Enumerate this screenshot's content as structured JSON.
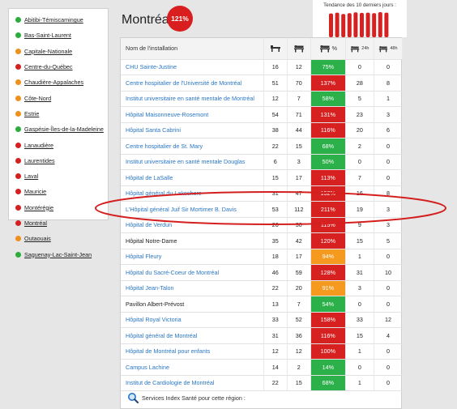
{
  "page": {
    "title": "Montréal",
    "badge": "121%",
    "trend_title": "Tendance des 10 derniers jours :",
    "trend_values": [
      0.92,
      0.95,
      0.9,
      0.93,
      0.96,
      0.94,
      0.95,
      0.93,
      0.97,
      0.95
    ],
    "footer_text": "Services Index Santé pour cette région :"
  },
  "sidebar": {
    "items": [
      {
        "label": "Abitibi-Témiscamingue",
        "status": "green"
      },
      {
        "label": "Bas-Saint-Laurent",
        "status": "green"
      },
      {
        "label": "Capitale-Nationale",
        "status": "orange"
      },
      {
        "label": "Centre-du-Québec",
        "status": "red"
      },
      {
        "label": "Chaudière-Appalaches",
        "status": "orange"
      },
      {
        "label": "Côte-Nord",
        "status": "orange"
      },
      {
        "label": "Estrie",
        "status": "orange"
      },
      {
        "label": "Gaspésie-Îles-de-la-Madeleine",
        "status": "green"
      },
      {
        "label": "Lanaudière",
        "status": "red"
      },
      {
        "label": "Laurentides",
        "status": "red"
      },
      {
        "label": "Laval",
        "status": "red"
      },
      {
        "label": "Mauricie",
        "status": "red"
      },
      {
        "label": "Montérégie",
        "status": "red"
      },
      {
        "label": "Montréal",
        "status": "red"
      },
      {
        "label": "Outaouais",
        "status": "orange"
      },
      {
        "label": "Saguenay-Lac-Saint-Jean",
        "status": "green"
      }
    ]
  },
  "table": {
    "headers": {
      "name": "Nom de l'installation",
      "pct": "%",
      "h24": "24h",
      "h48": "48h"
    },
    "rows": [
      {
        "name": "CHU Sainte-Justine",
        "link": true,
        "a": "16",
        "b": "12",
        "pct": "75%",
        "status": "green",
        "h24": "0",
        "h48": "0"
      },
      {
        "name": "Centre hospitalier de l'Université de Montréal",
        "link": true,
        "a": "51",
        "b": "70",
        "pct": "137%",
        "status": "red",
        "h24": "28",
        "h48": "8"
      },
      {
        "name": "Institut universitaire en santé mentale de Montréal",
        "link": true,
        "a": "12",
        "b": "7",
        "pct": "58%",
        "status": "green",
        "h24": "5",
        "h48": "1"
      },
      {
        "name": "Hôpital Maisonneuve-Rosemont",
        "link": true,
        "a": "54",
        "b": "71",
        "pct": "131%",
        "status": "red",
        "h24": "23",
        "h48": "3"
      },
      {
        "name": "Hôpital Santa Cabrini",
        "link": true,
        "a": "38",
        "b": "44",
        "pct": "116%",
        "status": "red",
        "h24": "20",
        "h48": "6"
      },
      {
        "name": "Centre hospitalier de St. Mary",
        "link": true,
        "a": "22",
        "b": "15",
        "pct": "68%",
        "status": "green",
        "h24": "2",
        "h48": "0"
      },
      {
        "name": "Institut universitaire en santé mentale Douglas",
        "link": true,
        "a": "6",
        "b": "3",
        "pct": "50%",
        "status": "green",
        "h24": "0",
        "h48": "0"
      },
      {
        "name": "Hôpital de LaSalle",
        "link": true,
        "a": "15",
        "b": "17",
        "pct": "113%",
        "status": "red",
        "h24": "7",
        "h48": "0"
      },
      {
        "name": "Hôpital général du Lakeshore",
        "link": true,
        "a": "31",
        "b": "47",
        "pct": "152%",
        "status": "red",
        "h24": "16",
        "h48": "8"
      },
      {
        "name": "L'Hôpital général Juif Sir Mortimer B. Davis",
        "link": true,
        "a": "53",
        "b": "112",
        "pct": "211%",
        "status": "red",
        "h24": "19",
        "h48": "3"
      },
      {
        "name": "Hôpital de Verdun",
        "link": true,
        "a": "26",
        "b": "30",
        "pct": "115%",
        "status": "red",
        "h24": "9",
        "h48": "3"
      },
      {
        "name": "Hôpital Notre-Dame",
        "link": false,
        "a": "35",
        "b": "42",
        "pct": "120%",
        "status": "red",
        "h24": "15",
        "h48": "5"
      },
      {
        "name": "Hôpital Fleury",
        "link": true,
        "a": "18",
        "b": "17",
        "pct": "94%",
        "status": "orange",
        "h24": "1",
        "h48": "0"
      },
      {
        "name": "Hôpital du Sacré-Coeur de Montréal",
        "link": true,
        "a": "46",
        "b": "59",
        "pct": "128%",
        "status": "red",
        "h24": "31",
        "h48": "10"
      },
      {
        "name": "Hôpital Jean-Talon",
        "link": true,
        "a": "22",
        "b": "20",
        "pct": "91%",
        "status": "orange",
        "h24": "3",
        "h48": "0"
      },
      {
        "name": "Pavillon Albert-Prévost",
        "link": false,
        "a": "13",
        "b": "7",
        "pct": "54%",
        "status": "green",
        "h24": "0",
        "h48": "0"
      },
      {
        "name": "Hôpital Royal Victoria",
        "link": true,
        "a": "33",
        "b": "52",
        "pct": "158%",
        "status": "red",
        "h24": "33",
        "h48": "12"
      },
      {
        "name": "Hôpital général de Montréal",
        "link": true,
        "a": "31",
        "b": "36",
        "pct": "116%",
        "status": "red",
        "h24": "15",
        "h48": "4"
      },
      {
        "name": "Hôpital de Montréal pour enfants",
        "link": true,
        "a": "12",
        "b": "12",
        "pct": "100%",
        "status": "red",
        "h24": "1",
        "h48": "0"
      },
      {
        "name": "Campus Lachine",
        "link": true,
        "a": "14",
        "b": "2",
        "pct": "14%",
        "status": "green",
        "h24": "0",
        "h48": "0"
      },
      {
        "name": "Institut de Cardiologie de Montréal",
        "link": true,
        "a": "22",
        "b": "15",
        "pct": "68%",
        "status": "green",
        "h24": "1",
        "h48": "0"
      }
    ]
  },
  "colors": {
    "green": "#2bb04a",
    "orange": "#f59a1e",
    "red": "#d72020",
    "link": "#2a77c6"
  }
}
